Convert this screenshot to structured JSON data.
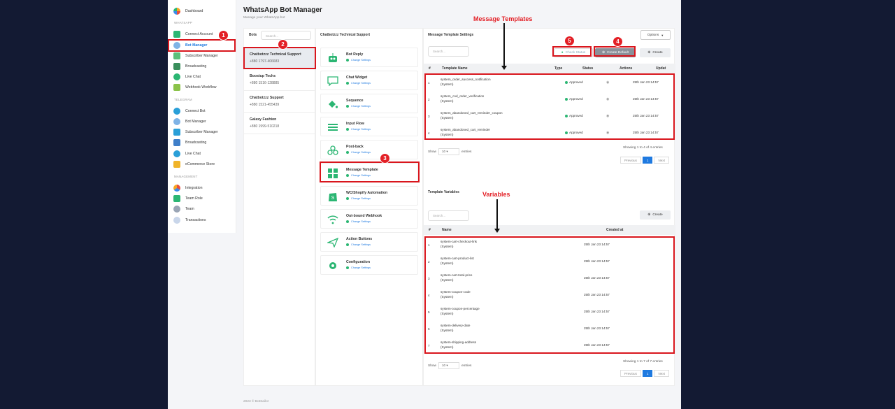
{
  "app": {
    "title": "WhatsApp Bot Manager",
    "subtitle": "Manage your WhatsApp bot",
    "footer": "2023 © BotSailor"
  },
  "sidebar": {
    "dashboard": "Dashboard",
    "section_whatsapp": "WHATSAPP",
    "wa_items": [
      "Connect Account",
      "Bot Manager",
      "Subscriber Manager",
      "Broadcasting",
      "Live Chat",
      "Webhook Workflow"
    ],
    "section_telegram": "TELEGRAM",
    "tg_items": [
      "Connect Bot",
      "Bot Manager",
      "Subscriber Manager",
      "Broadcasting",
      "Live Chat",
      "eCommerce Store"
    ],
    "section_management": "MANAGEMENT",
    "mg_items": [
      "Integration",
      "Team Role",
      "Team",
      "Transactions"
    ]
  },
  "bots_panel": {
    "title": "Bots",
    "search_placeholder": "Search...",
    "bots": [
      {
        "name": "Chatbotzzz Technical Support",
        "phone": "+880 1797-406683"
      },
      {
        "name": "Boostup Techs",
        "phone": "+880 1516-128885"
      },
      {
        "name": "Chatbotzzz Support",
        "phone": "+880 1521-455439"
      },
      {
        "name": "Galaxy Fashion",
        "phone": "+880 1999-510218"
      }
    ]
  },
  "settings_panel": {
    "title": "Chatbotzzz Technical Support",
    "change_label": "Change Settings",
    "cards": [
      "Bot Reply",
      "Chat Widget",
      "Sequence",
      "Input Flow",
      "Post-back",
      "Message Template",
      "WC/Shopify Automation",
      "Out-bound Webhook",
      "Action Buttons",
      "Configuration"
    ]
  },
  "template_settings": {
    "title": "Message Template Settings",
    "options": "Options",
    "search_placeholder": "Search...",
    "check_status": "Check Status",
    "create_default": "Create Default",
    "create": "Create",
    "columns": [
      "#",
      "Template Name",
      "Type",
      "Status",
      "Actions",
      "Updat"
    ],
    "rows": [
      {
        "num": "1",
        "name": "system_order_success_notification",
        "sub": "(System)",
        "status": "Approved",
        "date": "25th Jan 23 14:57"
      },
      {
        "num": "2",
        "name": "system_cod_order_verification",
        "sub": "(System)",
        "status": "Approved",
        "date": "25th Jan 23 14:57"
      },
      {
        "num": "3",
        "name": "system_abandoned_cart_reminder_coupon",
        "sub": "(System)",
        "status": "Approved",
        "date": "25th Jan 23 14:57"
      },
      {
        "num": "4",
        "name": "system_abandoned_cart_reminder",
        "sub": "(System)",
        "status": "Approved",
        "date": "25th Jan 23 14:57"
      }
    ],
    "show": "Show",
    "show_value": "10",
    "entries": "entries",
    "info": "Showing 1 to 4 of 4 entries",
    "prev": "Previous",
    "page": "1",
    "next": "Next"
  },
  "template_variables": {
    "title": "Template Variables",
    "search_placeholder": "Search...",
    "create": "Create",
    "columns": [
      "#",
      "Name",
      "Created at"
    ],
    "rows": [
      {
        "num": "1",
        "name": "system-cart-checkout-link",
        "sub": "(System)",
        "date": "25th Jan 23 14:57"
      },
      {
        "num": "2",
        "name": "system-cart-product-list",
        "sub": "(System)",
        "date": "25th Jan 23 14:57"
      },
      {
        "num": "3",
        "name": "system-cart-total-price",
        "sub": "(System)",
        "date": "25th Jan 23 14:57"
      },
      {
        "num": "4",
        "name": "system-coupon-code",
        "sub": "(System)",
        "date": "25th Jan 23 14:57"
      },
      {
        "num": "5",
        "name": "system-coupon-percentage",
        "sub": "(System)",
        "date": "25th Jan 23 14:57"
      },
      {
        "num": "6",
        "name": "system-delivery-date",
        "sub": "(System)",
        "date": "25th Jan 23 14:57"
      },
      {
        "num": "7",
        "name": "system-shipping-address",
        "sub": "(System)",
        "date": "25th Jan 23 14:57"
      }
    ],
    "show": "Show",
    "show_value": "10",
    "entries": "entries",
    "info": "Showing 1 to 7 of 7 entries",
    "prev": "Previous",
    "page": "1",
    "next": "Next"
  },
  "annotations": {
    "message_templates": "Message Templates",
    "variables": "Variables",
    "badges": [
      "1",
      "2",
      "3",
      "4",
      "5"
    ]
  },
  "colors": {
    "accent": "#1f7ae0",
    "highlight": "#e32026",
    "approved": "#2bb673",
    "whatsapp": "#2bb673"
  }
}
